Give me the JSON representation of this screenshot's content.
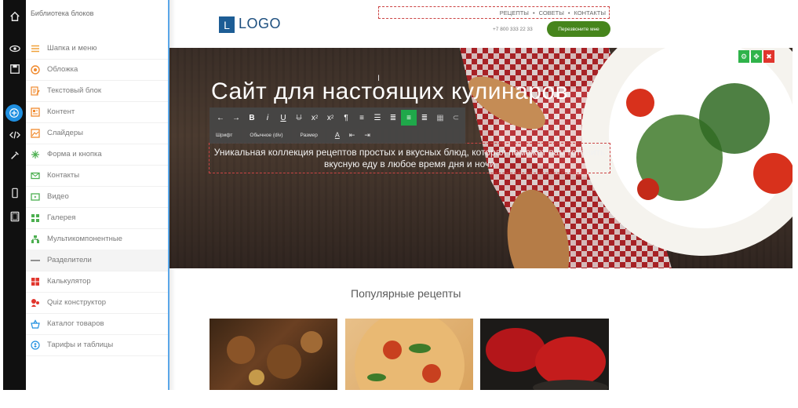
{
  "builder": {
    "panel_title": "Библиотека блоков",
    "items": [
      {
        "label": "Шапка и меню",
        "icon": "menu-icon",
        "color": "#f0a13a"
      },
      {
        "label": "Обложка",
        "icon": "target-icon",
        "color": "#f08a2e"
      },
      {
        "label": "Текстовый блок",
        "icon": "text-block-icon",
        "color": "#f08a2e"
      },
      {
        "label": "Контент",
        "icon": "content-icon",
        "color": "#f08a2e"
      },
      {
        "label": "Слайдеры",
        "icon": "slider-icon",
        "color": "#f08a2e"
      },
      {
        "label": "Форма и кнопка",
        "icon": "form-icon",
        "color": "#4caf50"
      },
      {
        "label": "Контакты",
        "icon": "contacts-icon",
        "color": "#4caf50"
      },
      {
        "label": "Видео",
        "icon": "video-icon",
        "color": "#4caf50"
      },
      {
        "label": "Галерея",
        "icon": "gallery-icon",
        "color": "#4caf50"
      },
      {
        "label": "Мультикомпонентные",
        "icon": "multi-icon",
        "color": "#4caf50"
      },
      {
        "label": "Разделители",
        "icon": "divider-icon",
        "color": "#777777"
      },
      {
        "label": "Калькулятор",
        "icon": "calculator-icon",
        "color": "#e1352d"
      },
      {
        "label": "Quiz конструктор",
        "icon": "quiz-icon",
        "color": "#e1352d"
      },
      {
        "label": "Каталог товаров",
        "icon": "basket-icon",
        "color": "#1f8fe0"
      },
      {
        "label": "Тарифы и таблицы",
        "icon": "pricing-icon",
        "color": "#1f8fe0"
      }
    ],
    "rail_icons": [
      "home-icon",
      "eye-icon",
      "save-icon",
      "add-icon",
      "code-icon",
      "eyedropper-icon",
      "phone-icon",
      "tablet-icon"
    ],
    "accent": "#1f8fe0"
  },
  "site": {
    "logo_letter": "L",
    "logo_text": "LOGO",
    "nav": [
      "РЕЦЕПТЫ",
      "•",
      "СОВЕТЫ",
      "•",
      "КОНТАКТЫ"
    ],
    "phone": "+7 800 333 22 33",
    "call_button": "Перезвоните мне",
    "hero_title": "Сайт для настоящих кулинаров",
    "hero_subtitle": "Уникальная коллекция рецептов простых и вкусных блюд, которая поможет вам готовить вкусную еду в любое время дня и ночи",
    "popular_title": "Популярные рецепты"
  },
  "toolbar": {
    "font_label": "Шрифт",
    "style_label": "Обычное (div)",
    "size_label": "Размер",
    "buttons": [
      "undo-icon",
      "redo-icon",
      "bold-icon",
      "italic-icon",
      "underline-icon",
      "strikethrough-icon",
      "subscript-icon",
      "superscript-icon",
      "paragraph-icon",
      "ordered-list-icon",
      "unordered-list-icon",
      "align-left-icon",
      "align-center-icon",
      "align-right-icon",
      "table-icon",
      "link-icon"
    ]
  }
}
